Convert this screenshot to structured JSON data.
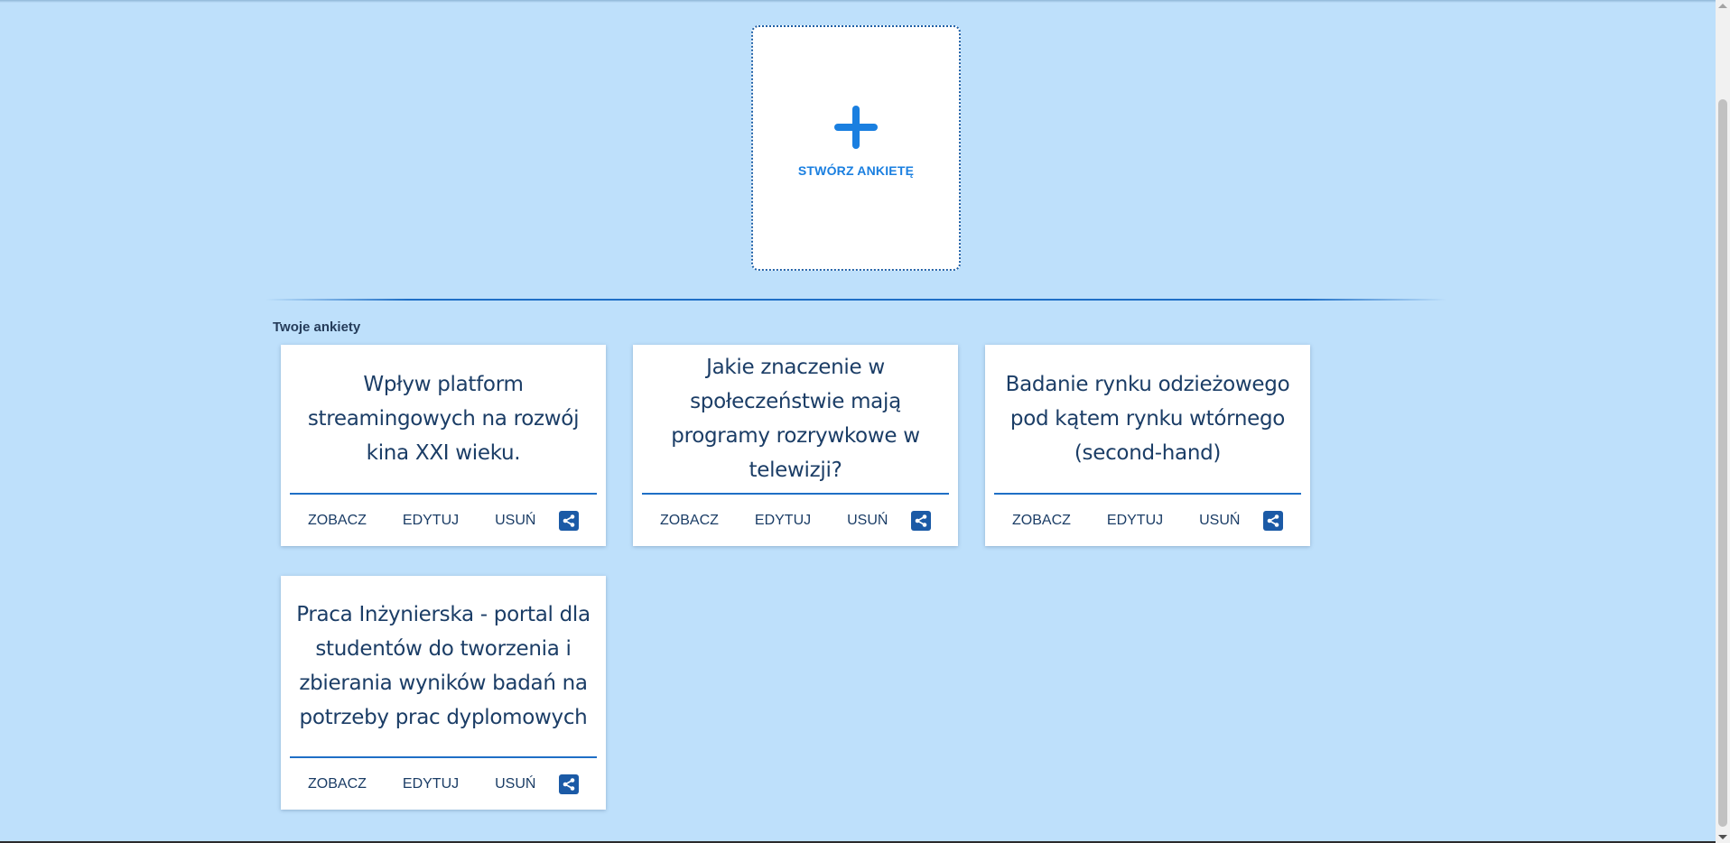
{
  "create": {
    "label": "STWÓRZ ANKIETĘ",
    "icon": "plus-icon"
  },
  "section": {
    "title": "Twoje ankiety"
  },
  "surveys": [
    {
      "title": "Wpływ platform streamingowych na rozwój kina XXI wieku.",
      "view": "ZOBACZ",
      "edit": "EDYTUJ",
      "delete": "USUŃ",
      "share_icon": "share-icon"
    },
    {
      "title": "Jakie znaczenie w społeczeństwie mają programy rozrywkowe w telewizji?",
      "view": "ZOBACZ",
      "edit": "EDYTUJ",
      "delete": "USUŃ",
      "share_icon": "share-icon"
    },
    {
      "title": "Badanie rynku odzieżowego pod kątem rynku wtórnego (second-hand)",
      "view": "ZOBACZ",
      "edit": "EDYTUJ",
      "delete": "USUŃ",
      "share_icon": "share-icon"
    },
    {
      "title": "Praca Inżynierska - portal dla studentów do tworzenia i zbierania wyników badań na potrzeby prac dyplomowych",
      "view": "ZOBACZ",
      "edit": "EDYTUJ",
      "delete": "USUŃ",
      "share_icon": "share-icon"
    }
  ],
  "colors": {
    "background": "#bee0fb",
    "accent": "#1a7fe0",
    "text": "#1b3d66",
    "share_button": "#1b5aa6"
  }
}
